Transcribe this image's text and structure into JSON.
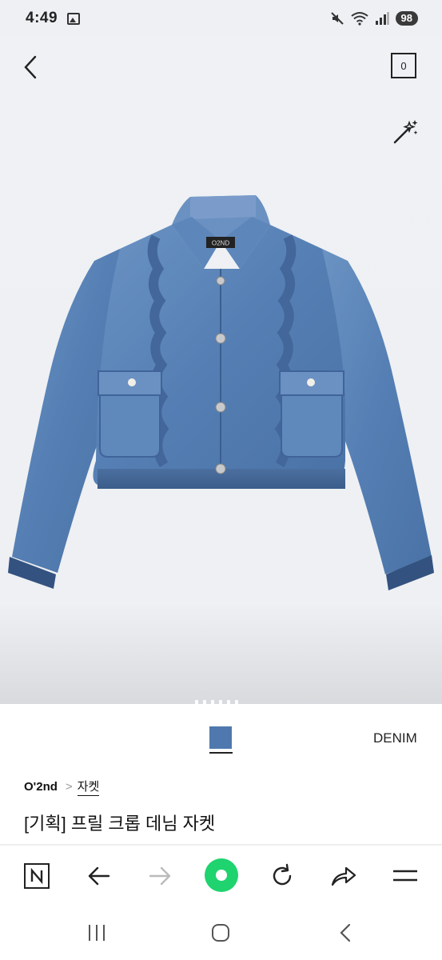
{
  "status_bar": {
    "time": "4:49",
    "battery": "98",
    "icons": [
      "gallery-icon",
      "mute-icon",
      "wifi-icon",
      "signal-icon"
    ]
  },
  "header": {
    "back_icon": "chevron-left-icon",
    "cart_count": "0",
    "magic_icon": "magic-wand-icon"
  },
  "gallery": {
    "page_count": 6,
    "label_on_jacket": "O2ND"
  },
  "product": {
    "color_name": "DENIM",
    "swatch_color": "#4f79ae",
    "brand": "O'2nd",
    "category": "자켓",
    "title": "[기획] 프릴 크롭 데님 자켓"
  },
  "toolbar": {
    "items": [
      "naver-icon",
      "back-arrow-icon",
      "forward-arrow-icon",
      "home-icon",
      "refresh-icon",
      "share-icon",
      "menu-icon"
    ],
    "accent": "#1fd36f"
  },
  "system_nav": {
    "items": [
      "recent-apps-icon",
      "home-circle-icon",
      "back-icon"
    ]
  }
}
